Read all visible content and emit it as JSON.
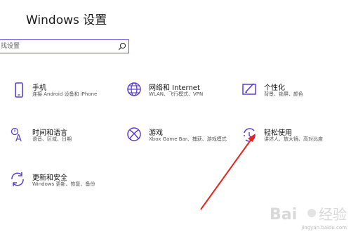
{
  "window": {
    "title": "Windows 设置"
  },
  "search": {
    "placeholder": "找设置"
  },
  "tiles": [
    {
      "name": "手机",
      "description": "连接 Android 设备和 iPhone",
      "icon": "phone-icon"
    },
    {
      "name": "网络和 Internet",
      "description": "WLAN、飞行模式、VPN",
      "icon": "globe-icon"
    },
    {
      "name": "个性化",
      "description": "背景、锁屏、颜色",
      "icon": "personalization-icon"
    },
    {
      "name": "时间和语言",
      "description": "语音、区域、日期",
      "icon": "time-language-icon"
    },
    {
      "name": "游戏",
      "description": "Xbox Game Bar、捕获、游戏模式",
      "icon": "xbox-icon"
    },
    {
      "name": "轻松使用",
      "description": "讲述人、放大镜、高对比度",
      "icon": "ease-of-access-icon"
    },
    {
      "name": "更新和安全",
      "description": "Windows 更新、恢复、备份",
      "icon": "update-icon"
    }
  ],
  "watermark": {
    "text": "jingyan.baidu.com"
  },
  "colors": {
    "accent": "#5a3fd6",
    "arrow": "#e8241b"
  }
}
